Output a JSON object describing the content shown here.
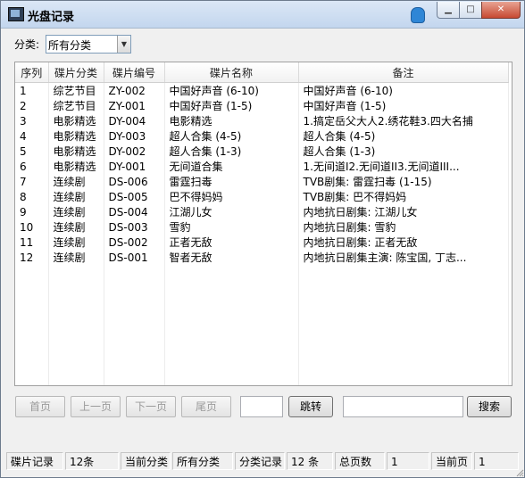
{
  "window": {
    "title": "光盘记录"
  },
  "filter": {
    "label": "分类:",
    "selected": "所有分类"
  },
  "table": {
    "columns": [
      "序列",
      "碟片分类",
      "碟片编号",
      "碟片名称",
      "备注"
    ],
    "rows": [
      [
        "1",
        "综艺节目",
        "ZY-002",
        "中国好声音 (6-10)",
        "中国好声音 (6-10)"
      ],
      [
        "2",
        "综艺节目",
        "ZY-001",
        "中国好声音 (1-5)",
        "中国好声音 (1-5)"
      ],
      [
        "3",
        "电影精选",
        "DY-004",
        "电影精选",
        "1.搞定岳父大人2.绣花鞋3.四大名捕"
      ],
      [
        "4",
        "电影精选",
        "DY-003",
        "超人合集 (4-5)",
        "超人合集 (4-5)"
      ],
      [
        "5",
        "电影精选",
        "DY-002",
        "超人合集 (1-3)",
        "超人合集 (1-3)"
      ],
      [
        "6",
        "电影精选",
        "DY-001",
        "无间道合集",
        "1.无间道I2.无间道II3.无间道III..."
      ],
      [
        "7",
        "连续剧",
        "DS-006",
        "雷霆扫毒",
        "TVB剧集: 雷霆扫毒 (1-15)"
      ],
      [
        "8",
        "连续剧",
        "DS-005",
        "巴不得妈妈",
        "TVB剧集: 巴不得妈妈"
      ],
      [
        "9",
        "连续剧",
        "DS-004",
        "江湖儿女",
        "内地抗日剧集: 江湖儿女"
      ],
      [
        "10",
        "连续剧",
        "DS-003",
        "雪豹",
        "内地抗日剧集: 雪豹"
      ],
      [
        "11",
        "连续剧",
        "DS-002",
        "正者无敌",
        "内地抗日剧集: 正者无敌"
      ],
      [
        "12",
        "连续剧",
        "DS-001",
        "智者无敌",
        "内地抗日剧集主演: 陈宝国, 丁志..."
      ]
    ]
  },
  "pager": {
    "first": "首页",
    "prev": "上一页",
    "next": "下一页",
    "last": "尾页",
    "goto": "跳转",
    "goto_value": "",
    "search": "搜索",
    "search_value": ""
  },
  "status": {
    "disc_label": "碟片记录",
    "disc_value": "12条",
    "cat_label": "当前分类",
    "cat_value": "所有分类",
    "catrec_label": "分类记录",
    "catrec_value": "12 条",
    "pages_label": "总页数",
    "pages_value": "1",
    "cur_label": "当前页",
    "cur_value": "1"
  }
}
